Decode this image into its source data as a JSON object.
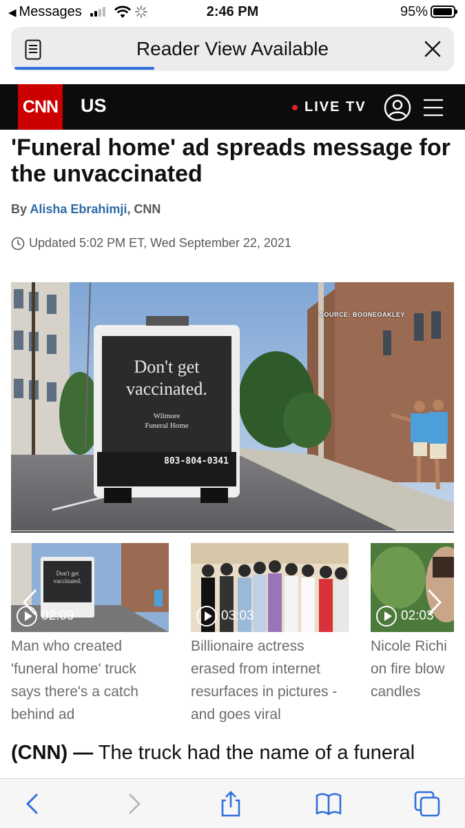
{
  "status_bar": {
    "back_app": "Messages",
    "time": "2:46 PM",
    "battery_percent": "95%",
    "battery_level": 0.95,
    "icons": [
      "signal-icon",
      "wifi-icon",
      "loading-spinner-icon",
      "battery-icon"
    ]
  },
  "reader_bar": {
    "text": "Reader View Available",
    "load_progress": 0.32,
    "icons": [
      "reader-doc-icon",
      "close-icon"
    ]
  },
  "cnn_header": {
    "logo": "CNN",
    "section": "US",
    "live_tv": "LIVE TV",
    "accent_color": "#cc0000",
    "icons": [
      "user-icon",
      "menu-icon"
    ]
  },
  "article": {
    "headline": "'Funeral home' ad spreads message for the unvaccinated",
    "by_prefix": "By ",
    "author": "Alisha Ebrahimji",
    "outlet_suffix": ", CNN",
    "updated": "Updated 5:02 PM ET, Wed September 22, 2021",
    "hero_image": {
      "source_label": "SOURCE: BOONEOAKLEY",
      "truck_line1": "Don't get",
      "truck_line2": "vaccinated.",
      "truck_brand": "Wilmore",
      "truck_brand2": "Funeral Home",
      "truck_phone": "803-804-0341"
    },
    "lede_dateline": "(CNN) —",
    "lede_text": " The truck had the name of a funeral"
  },
  "videos": [
    {
      "duration": "02:09",
      "caption": "Man who created 'funeral home' truck says there's a catch behind ad"
    },
    {
      "duration": "03:03",
      "caption": "Billionaire actress erased from internet resurfaces in pictures - and goes viral"
    },
    {
      "duration": "02:03",
      "caption": "Nicole Richi on fire blow candles"
    }
  ],
  "toolbar": {
    "icons": [
      "back-icon",
      "forward-icon",
      "share-icon",
      "bookmarks-icon",
      "tabs-icon"
    ]
  }
}
